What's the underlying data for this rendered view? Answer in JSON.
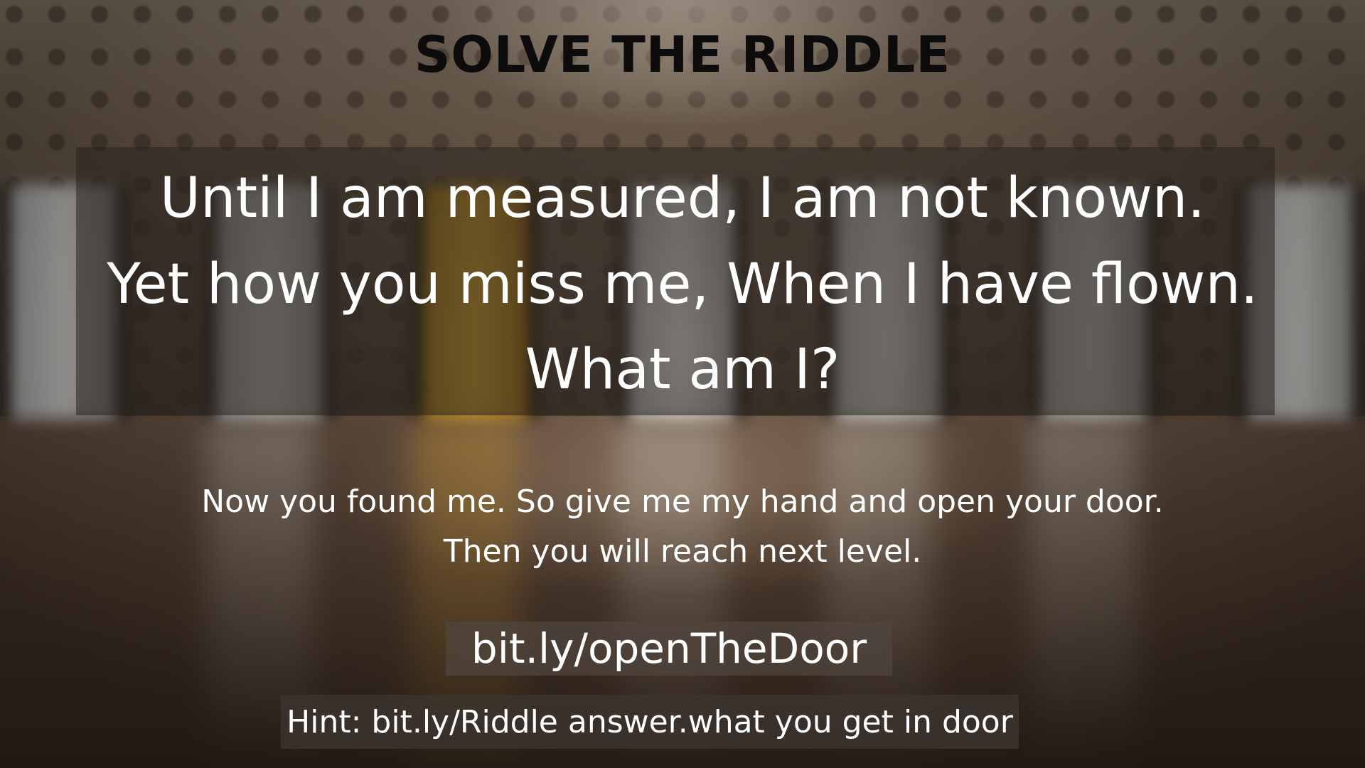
{
  "title": "SOLVE THE RIDDLE",
  "riddle": {
    "line1": "Until I am measured, I am not known.",
    "line2": "Yet how you miss me, When I have flown.",
    "line3": "What am I?"
  },
  "message": {
    "line1": "Now you found me. So give me my hand and open your door.",
    "line2": "Then you will reach next level."
  },
  "link": "bit.ly/openTheDoor",
  "hint": "Hint: bit.ly/Riddle answer.what you get in door",
  "colors": {
    "title": "#0c0c0c",
    "text": "#ffffff",
    "gold_door": "#e0ac35"
  }
}
